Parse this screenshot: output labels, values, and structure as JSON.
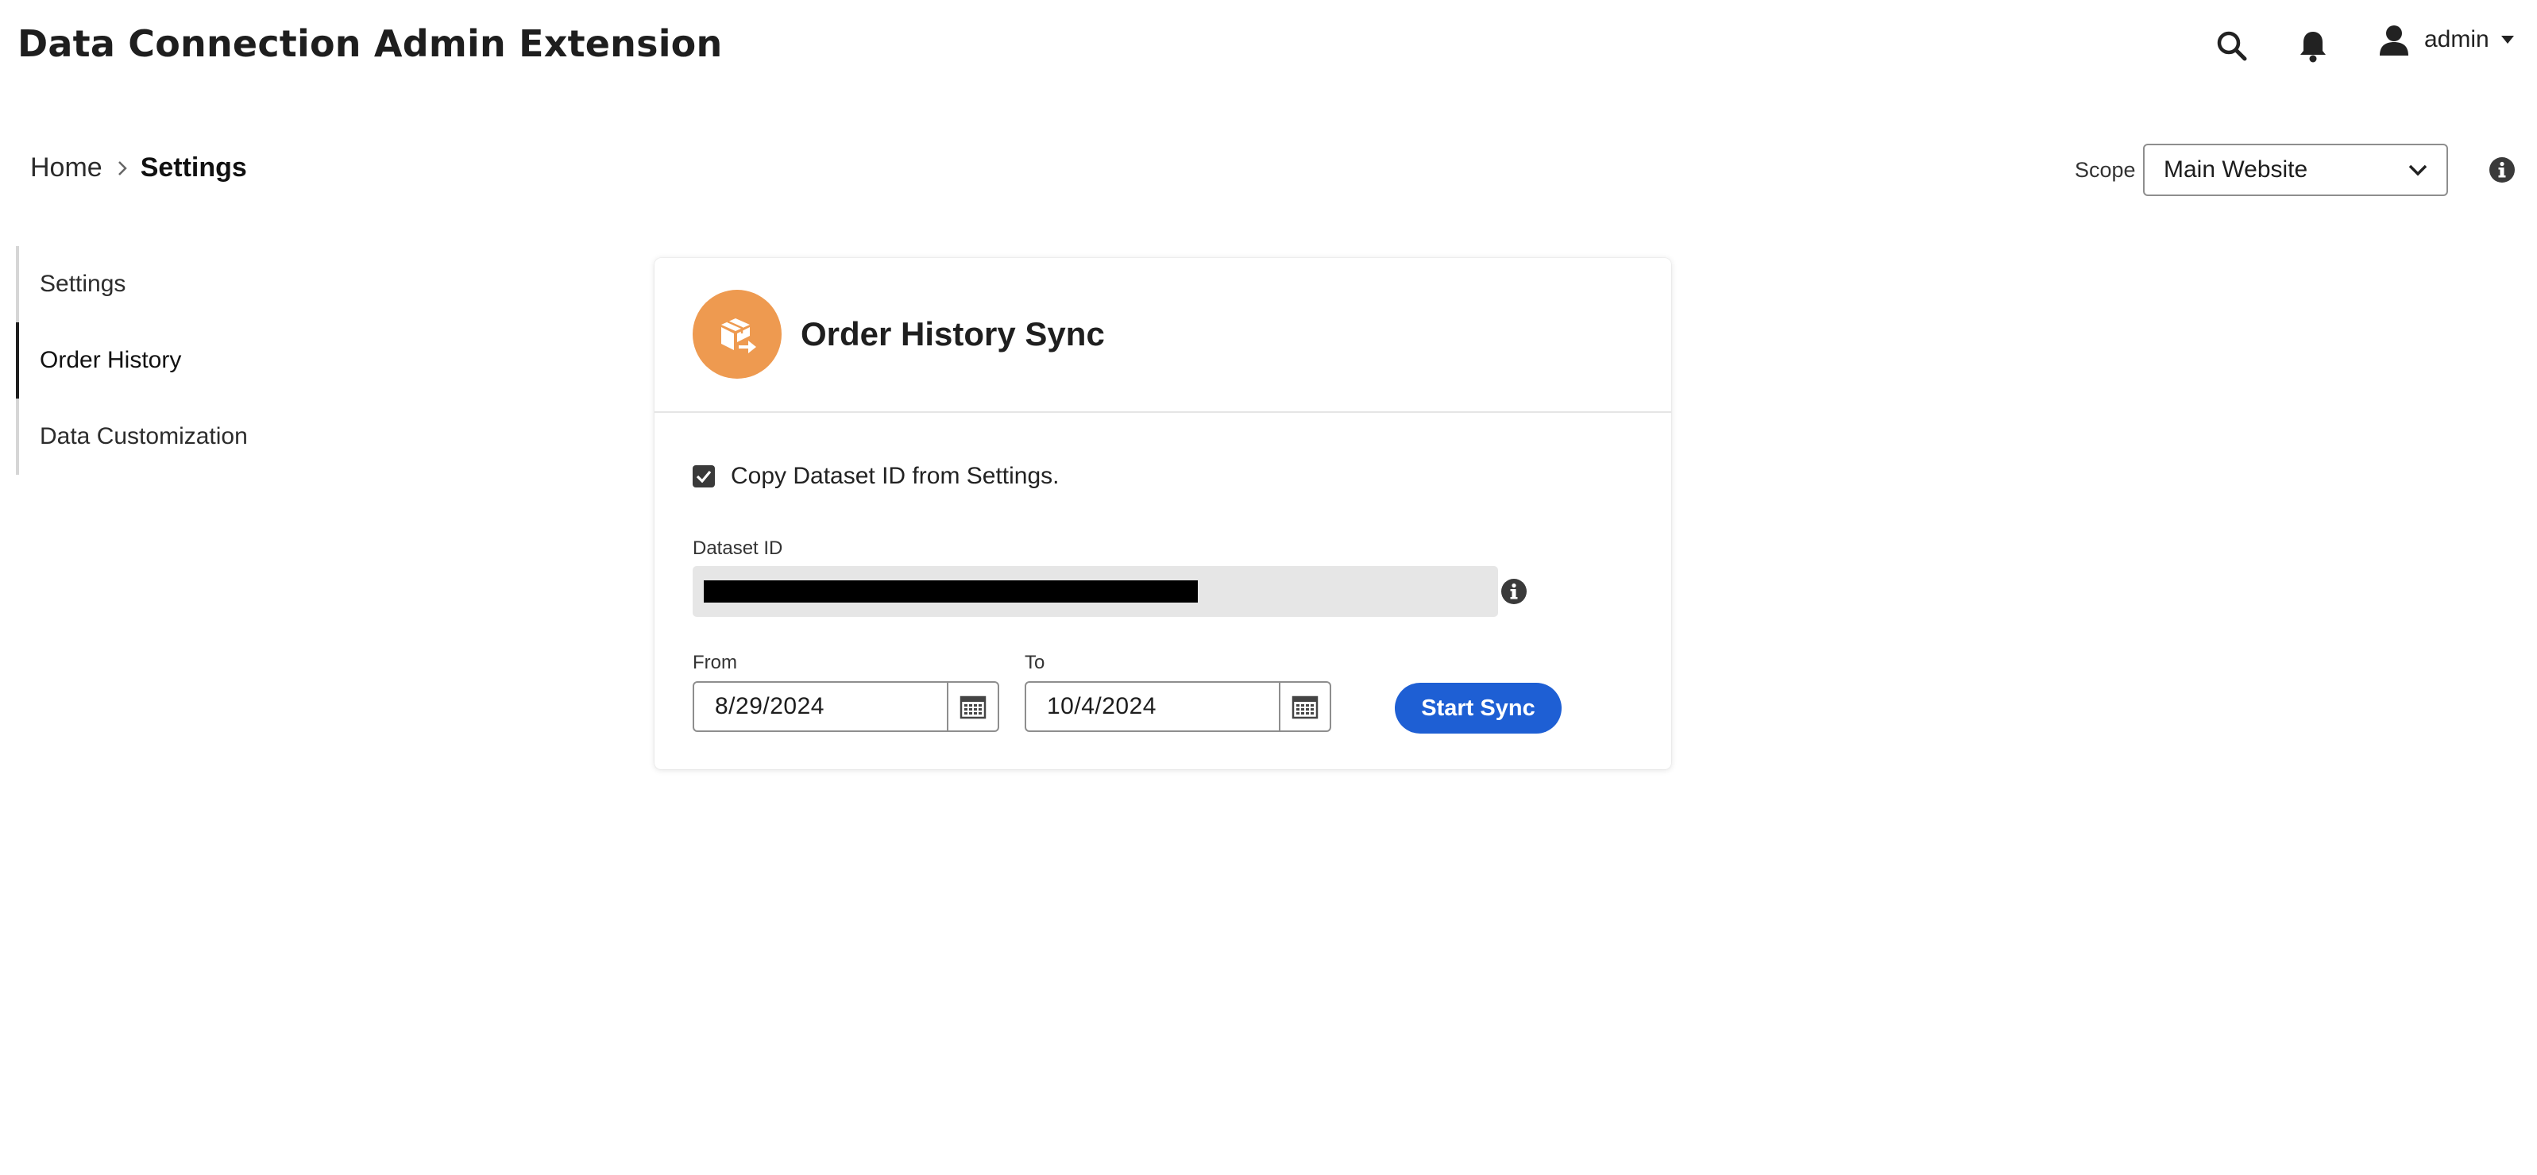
{
  "header": {
    "app_title": "Data Connection Admin Extension",
    "user_name": "admin"
  },
  "breadcrumb": {
    "home": "Home",
    "current": "Settings"
  },
  "scope": {
    "label": "Scope",
    "selected": "Main Website"
  },
  "sidenav": {
    "items": [
      {
        "label": "Settings",
        "active": false
      },
      {
        "label": "Order History",
        "active": true
      },
      {
        "label": "Data Customization",
        "active": false
      }
    ]
  },
  "card": {
    "title": "Order History Sync",
    "copy_checkbox_label": "Copy Dataset ID from Settings.",
    "copy_checked": true,
    "dataset_label": "Dataset ID",
    "from_label": "From",
    "from_value": "8/29/2024",
    "to_label": "To",
    "to_value": "10/4/2024",
    "start_button": "Start Sync"
  },
  "colors": {
    "accent_orange": "#ee9a50",
    "primary_blue": "#1e5fd4"
  }
}
